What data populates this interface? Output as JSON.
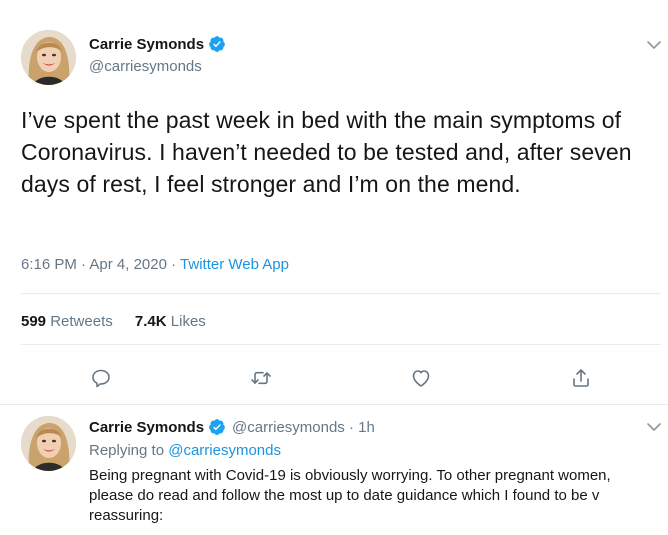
{
  "main_tweet": {
    "author": {
      "display_name": "Carrie Symonds",
      "handle": "@carriesymonds",
      "verified": true
    },
    "text": "I’ve spent the past week in bed with the main symptoms of Coronavirus. I haven’t needed to be tested and, after seven days of rest, I feel stronger and I’m on the mend.",
    "time": "6:16 PM",
    "date": "Apr 4, 2020",
    "separator": "·",
    "source": "Twitter Web App",
    "retweets_count": "599",
    "retweets_label": "Retweets",
    "likes_count": "7.4K",
    "likes_label": "Likes"
  },
  "reply_tweet": {
    "author": {
      "display_name": "Carrie Symonds",
      "handle": "@carriesymonds",
      "verified": true
    },
    "handle_time": "@carriesymonds · 1h",
    "replying_to_label": "Replying to",
    "replying_to_handle": "@carriesymonds",
    "text": "Being pregnant with Covid-19 is obviously worrying. To other pregnant women, please do read and follow the most up to date guidance which I found to be v reassuring:"
  },
  "icons": {
    "verified": "verified-badge-icon",
    "caret": "chevron-down-icon",
    "reply": "reply-icon",
    "retweet": "retweet-icon",
    "like": "heart-icon",
    "share": "share-icon"
  },
  "colors": {
    "accent": "#1b95e0",
    "verified": "#1da1f2",
    "secondary_text": "#657786",
    "primary_text": "#14171a",
    "divider": "#e6ecf0"
  }
}
